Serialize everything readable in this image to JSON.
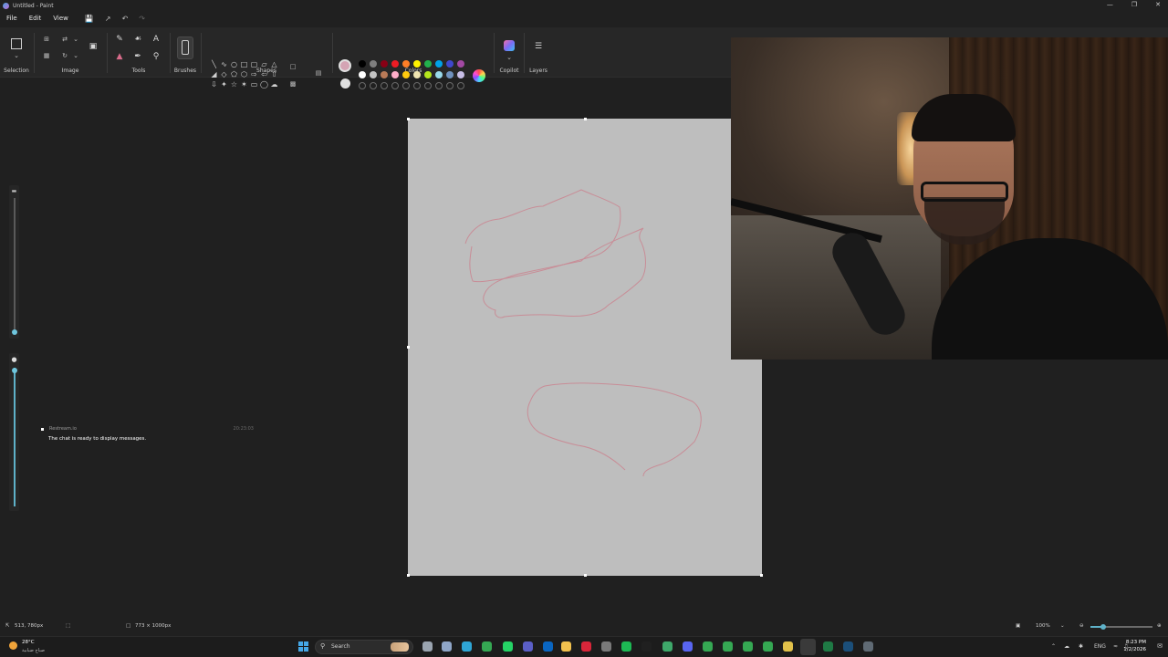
{
  "window": {
    "title": "Untitled - Paint",
    "controls": [
      "—",
      "❐",
      "✕"
    ]
  },
  "menu": {
    "file": "File",
    "edit": "Edit",
    "view": "View"
  },
  "ribbon": {
    "groups": {
      "selection": "Selection",
      "image": "Image",
      "tools": "Tools",
      "brushes": "Brushes",
      "shapes": "Shapes",
      "colors": "Colors",
      "copilot": "Copilot",
      "layers": "Layers"
    },
    "colors": {
      "primary": "#d4a4b4",
      "secondary": "#e0e0e0",
      "palette_row1": [
        "#000000",
        "#7f7f7f",
        "#880015",
        "#ed1c24",
        "#ff7f27",
        "#fff200",
        "#22b14c",
        "#00a2e8",
        "#3f48cc",
        "#a349a4"
      ],
      "palette_row2": [
        "#ffffff",
        "#c3c3c3",
        "#b97a57",
        "#ffaec9",
        "#ffc90e",
        "#efe4b0",
        "#b5e61d",
        "#99d9ea",
        "#7092be",
        "#c8bfe7"
      ]
    }
  },
  "chat": {
    "name": "Restream.io",
    "time": "20:23:03",
    "message": "The chat is ready to display messages."
  },
  "status": {
    "cursor_position": "513, 780px",
    "canvas_size": "773 × 1000px",
    "zoom": "100%"
  },
  "zoom_level": 0.2,
  "taskbar": {
    "temperature": "28°C",
    "condition": "صباح ضبابية",
    "search_placeholder": "Search",
    "language": "ENG",
    "time": "8:23 PM",
    "date": "1/2/2026"
  }
}
